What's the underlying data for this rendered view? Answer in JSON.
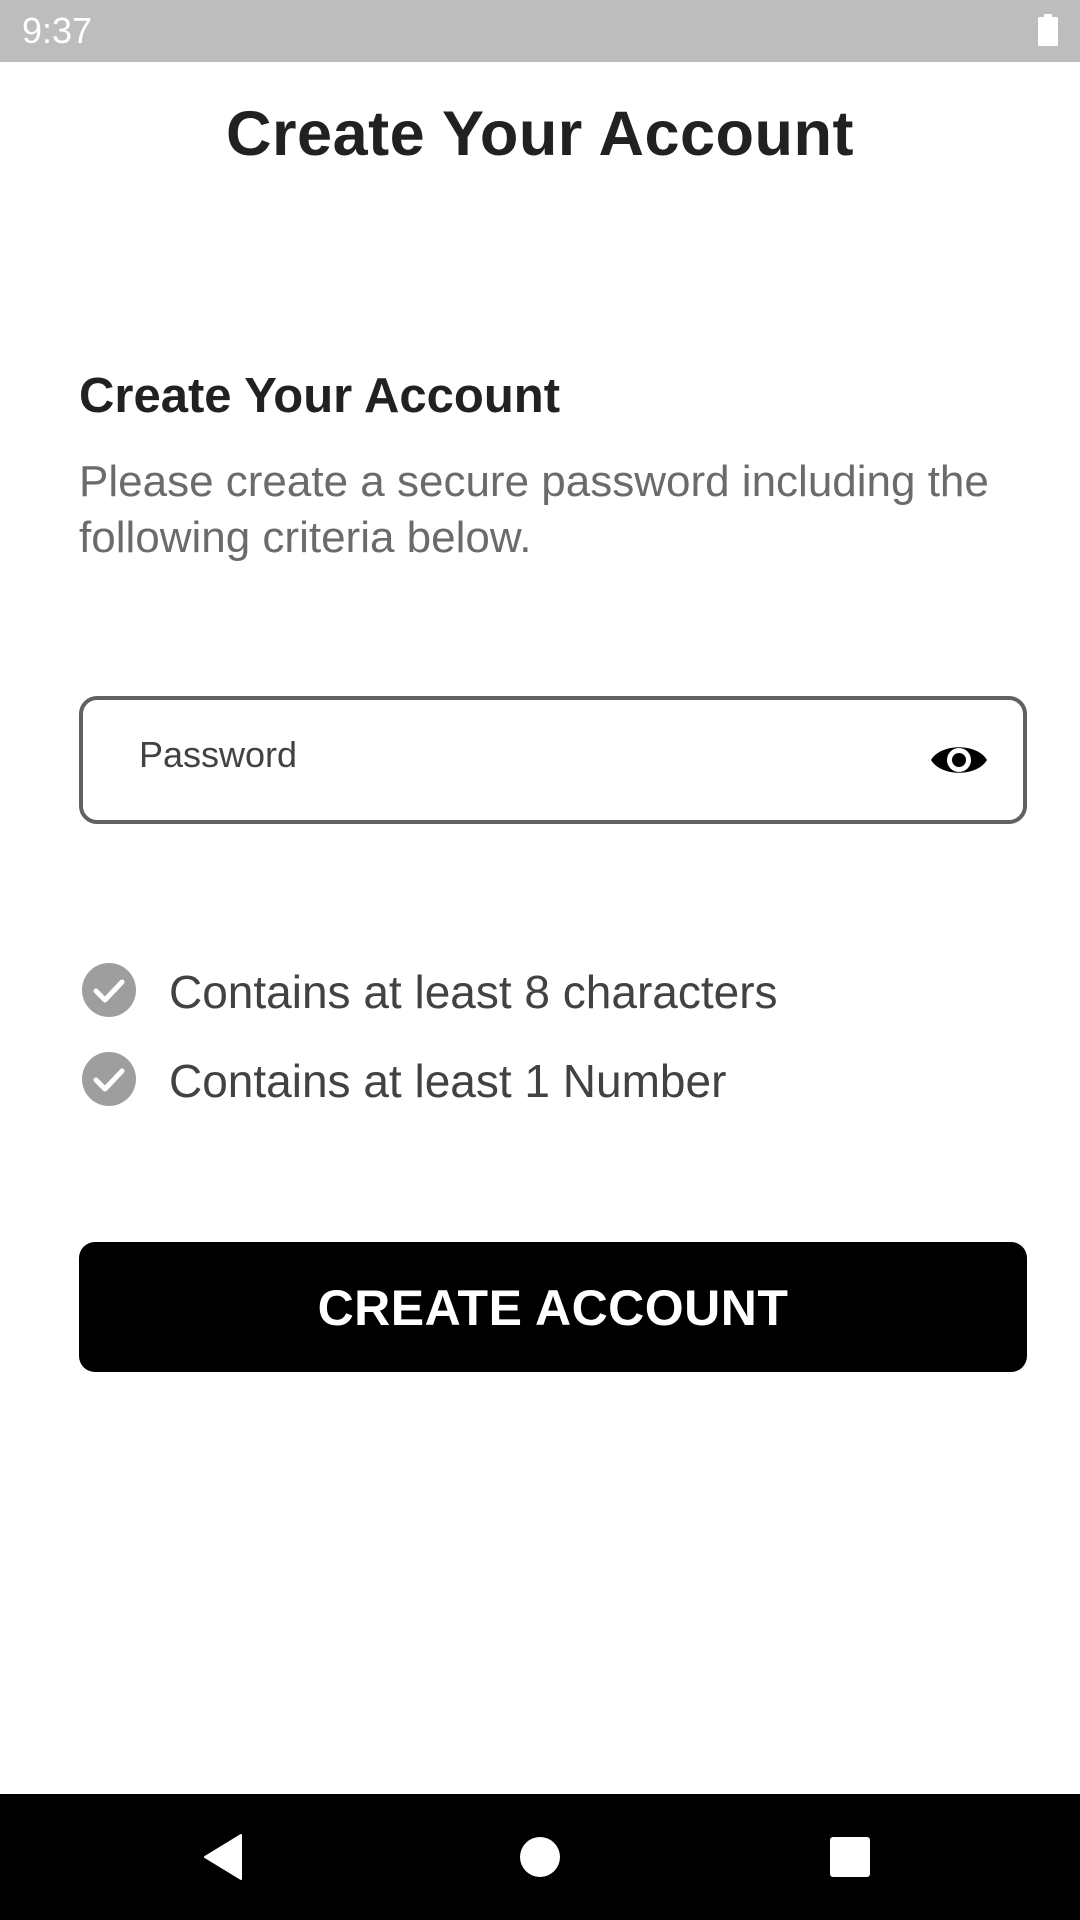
{
  "status_bar": {
    "time": "9:37",
    "battery_icon": "battery-full-icon"
  },
  "header": {
    "title": "Create Your Account"
  },
  "form": {
    "heading": "Create Your Account",
    "description": "Please create a secure password including the following criteria below.",
    "password": {
      "placeholder": "Password",
      "value": "",
      "toggle_icon": "eye-icon"
    },
    "criteria": [
      {
        "label": "Contains at least 8 characters",
        "met": true,
        "icon": "check-circle-icon"
      },
      {
        "label": "Contains at least 1 Number",
        "met": true,
        "icon": "check-circle-icon"
      }
    ],
    "submit_label": "CREATE ACCOUNT"
  },
  "nav_bar": {
    "back_icon": "back-triangle-icon",
    "home_icon": "home-circle-icon",
    "recents_icon": "recents-square-icon"
  },
  "colors": {
    "status_bar": "#bdbdbd",
    "primary_text": "#212121",
    "secondary_text": "#6b6b6b",
    "check_icon": "#9e9e9e",
    "button_bg": "#000000",
    "button_text": "#ffffff"
  }
}
